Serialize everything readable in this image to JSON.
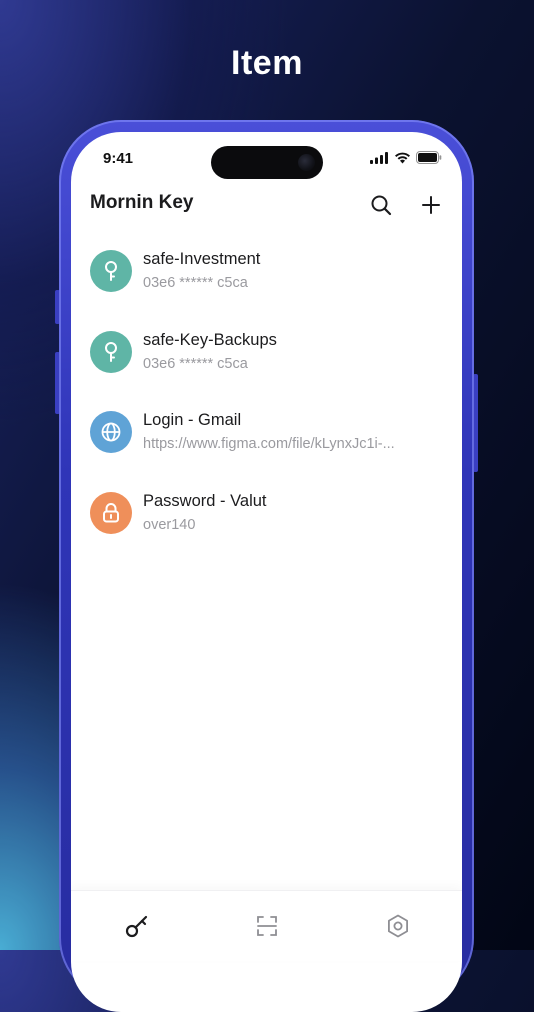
{
  "promo": {
    "title": "Item"
  },
  "status_bar": {
    "time": "9:41",
    "icons": [
      "cellular-signal-icon",
      "wifi-icon",
      "battery-icon"
    ]
  },
  "app": {
    "title": "Mornin Key"
  },
  "toolbar": {
    "search_icon": "search-icon",
    "add_icon": "plus-icon"
  },
  "items": [
    {
      "title": "safe-Investment",
      "subtitle": "03e6 ****** c5ca",
      "icon": "key-icon",
      "color": "#5fb5a6"
    },
    {
      "title": "safe-Key-Backups",
      "subtitle": "03e6 ****** c5ca",
      "icon": "key-icon",
      "color": "#5fb5a6"
    },
    {
      "title": "Login - Gmail",
      "subtitle": "https://www.figma.com/file/kLynxJc1i-...",
      "icon": "globe-icon",
      "color": "#5fa3d6"
    },
    {
      "title": "Password - Valut",
      "subtitle": "over140",
      "icon": "lock-icon",
      "color": "#ef8f5a"
    }
  ],
  "tabs": [
    {
      "icon": "key-icon",
      "active": true
    },
    {
      "icon": "scan-icon",
      "active": false
    },
    {
      "icon": "settings-hexagon-icon",
      "active": false
    }
  ],
  "colors": {
    "accent_teal": "#5fb5a6",
    "accent_blue": "#5fa3d6",
    "accent_orange": "#ef8f5a",
    "phone_frame": "#3a3fc2"
  }
}
